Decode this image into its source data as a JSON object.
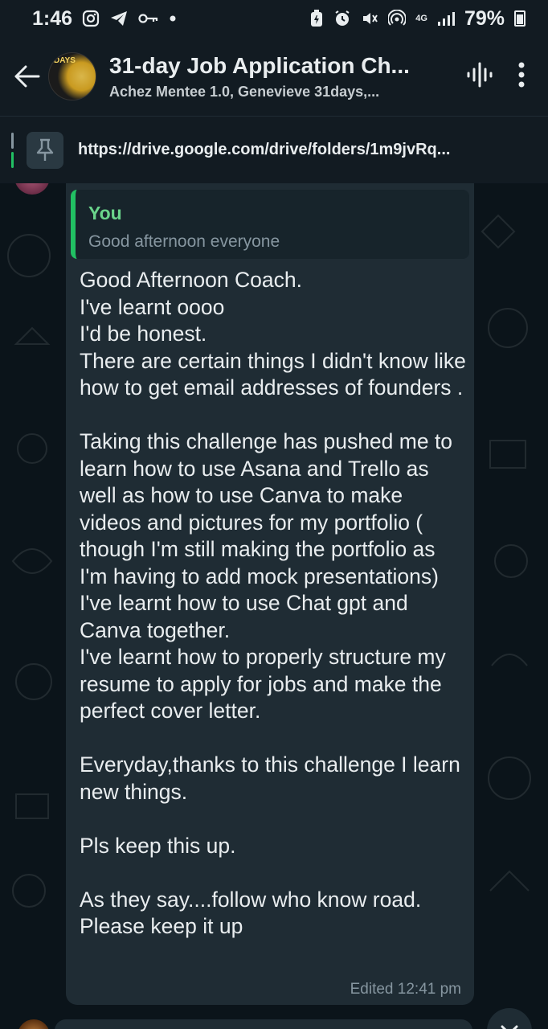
{
  "status_bar": {
    "time": "1:46",
    "network": "4G",
    "battery": "79%"
  },
  "header": {
    "title": "31-day Job Application Ch...",
    "subtitle": "Achez Mentee 1.0, Genevieve 31days,...",
    "avatar_text": "DAYS"
  },
  "pinned": {
    "text": "https://drive.google.com/drive/folders/1m9jvRq..."
  },
  "message": {
    "quote_author": "You",
    "quote_text": "Good afternoon everyone",
    "body": "Good Afternoon Coach.\nI've learnt oooo\nI'd be honest.\nThere are certain things I didn't know like how to get email addresses of founders .\n\nTaking this challenge has pushed me to learn how to use Asana and Trello as well as how to use Canva to make videos and pictures for my portfolio ( though I'm still making the portfolio as I'm having to add mock presentations)\nI've learnt how to use Chat gpt and Canva together.\nI've learnt how to properly structure my resume to apply for jobs and make the perfect cover letter.\n\nEveryday,thanks to this challenge I learn new things.\n\nPls keep this up.\n\nAs they say....follow who know road.\nPlease keep it up",
    "meta": "Edited 12:41 pm"
  },
  "colors": {
    "accent": "#21c063",
    "bubble": "#1f2c34",
    "background": "#0b141a"
  }
}
